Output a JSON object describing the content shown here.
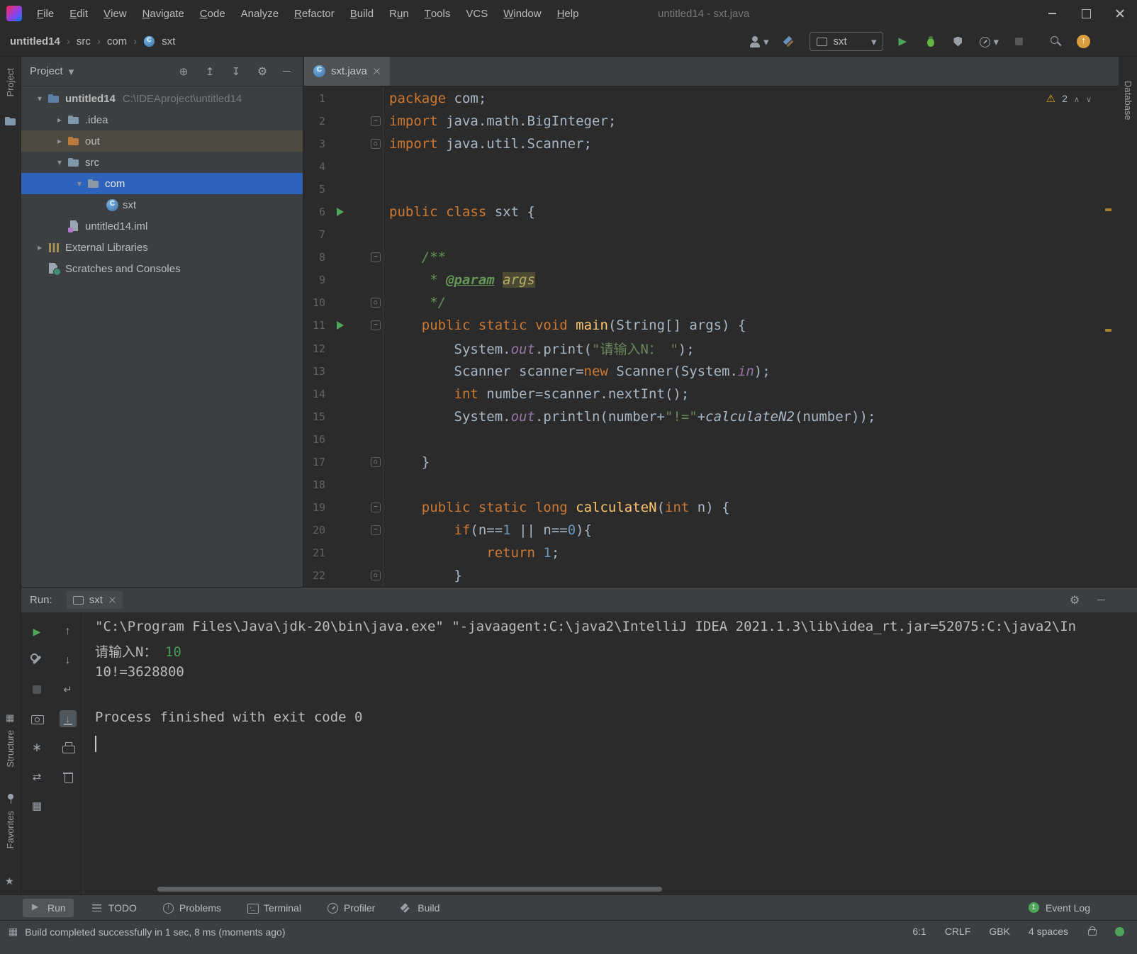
{
  "colors": {
    "background_editor": "#2b2b2b",
    "background_panel": "#3c3f41",
    "selection_blue": "#2d63bb",
    "tree_highlight_olive": "#4c4a41",
    "keyword_orange": "#cc7832",
    "string_green": "#6a8759",
    "number_blue": "#6897bb",
    "comment_green": "#629755",
    "method_yellow": "#ffc66d",
    "field_purple": "#9876aa",
    "run_green": "#4fa65a",
    "warning_yellow": "#d6a520",
    "console_input_green": "#499c54"
  },
  "window": {
    "title": "untitled14 - sxt.java"
  },
  "menubar": {
    "items": [
      {
        "label": "File",
        "u": 0
      },
      {
        "label": "Edit",
        "u": 0
      },
      {
        "label": "View",
        "u": 0
      },
      {
        "label": "Navigate",
        "u": 0
      },
      {
        "label": "Code",
        "u": 0
      },
      {
        "label": "Analyze",
        "u": null
      },
      {
        "label": "Refactor",
        "u": 0
      },
      {
        "label": "Build",
        "u": 0
      },
      {
        "label": "Run",
        "u": 1
      },
      {
        "label": "Tools",
        "u": 0
      },
      {
        "label": "VCS",
        "u": null
      },
      {
        "label": "Window",
        "u": 0
      },
      {
        "label": "Help",
        "u": 0
      }
    ]
  },
  "breadcrumbs": {
    "items": [
      {
        "label": "untitled14",
        "bold": true
      },
      {
        "label": "src"
      },
      {
        "label": "com"
      },
      {
        "label": "sxt",
        "icon": "class"
      }
    ]
  },
  "toolbar": {
    "run_config": "sxt"
  },
  "stripes": {
    "left_top": "Project",
    "left_bottom": [
      "Structure",
      "Favorites"
    ],
    "right_top": "Database"
  },
  "project": {
    "header": "Project",
    "tree": [
      {
        "indent": 0,
        "chevron": "down",
        "icon": "project-folder",
        "label": "untitled14",
        "bold": true,
        "path": "C:\\IDEAproject\\untitled14"
      },
      {
        "indent": 1,
        "chevron": "right",
        "icon": "folder",
        "label": ".idea"
      },
      {
        "indent": 1,
        "chevron": "right",
        "icon": "folder-out",
        "label": "out",
        "highlight": true
      },
      {
        "indent": 1,
        "chevron": "down",
        "icon": "folder-src",
        "label": "src"
      },
      {
        "indent": 2,
        "chevron": "down",
        "icon": "package",
        "label": "com",
        "selected": true
      },
      {
        "indent": 3,
        "chevron": null,
        "icon": "class",
        "label": "sxt"
      },
      {
        "indent": 1,
        "chevron": null,
        "icon": "iml",
        "label": "untitled14.iml"
      },
      {
        "indent": 0,
        "chevron": "right",
        "icon": "library",
        "label": "External Libraries"
      },
      {
        "indent": 0,
        "chevron": null,
        "icon": "scratches",
        "label": "Scratches and Consoles"
      }
    ]
  },
  "editor": {
    "tab": {
      "label": "sxt.java"
    },
    "warnings_count": "2",
    "lines": [
      {
        "n": "1",
        "seg": [
          [
            "k",
            "package"
          ],
          [
            "p",
            " com;"
          ]
        ]
      },
      {
        "n": "2",
        "fold": "start",
        "seg": [
          [
            "k",
            "import"
          ],
          [
            "p",
            " java.math.BigInteger;"
          ]
        ]
      },
      {
        "n": "3",
        "fold": "end",
        "seg": [
          [
            "k",
            "import"
          ],
          [
            "p",
            " java.util.Scanner;"
          ]
        ]
      },
      {
        "n": "4",
        "seg": []
      },
      {
        "n": "5",
        "seg": []
      },
      {
        "n": "6",
        "run": true,
        "seg": [
          [
            "k",
            "public"
          ],
          [
            "p",
            " "
          ],
          [
            "k",
            "class"
          ],
          [
            "p",
            " sxt {"
          ]
        ]
      },
      {
        "n": "7",
        "seg": []
      },
      {
        "n": "8",
        "fold": "start",
        "seg": [
          [
            "c",
            "    /**"
          ]
        ]
      },
      {
        "n": "9",
        "seg": [
          [
            "c",
            "     * "
          ],
          [
            "t",
            "@param"
          ],
          [
            "c",
            " "
          ],
          [
            "pr",
            "args"
          ]
        ]
      },
      {
        "n": "10",
        "fold": "end",
        "seg": [
          [
            "c",
            "     */"
          ]
        ]
      },
      {
        "n": "11",
        "run": true,
        "fold": "start",
        "seg": [
          [
            "p",
            "    "
          ],
          [
            "k",
            "public"
          ],
          [
            "p",
            " "
          ],
          [
            "k",
            "static"
          ],
          [
            "p",
            " "
          ],
          [
            "k",
            "void"
          ],
          [
            "p",
            " "
          ],
          [
            "m",
            "main"
          ],
          [
            "p",
            "(String[] args) {"
          ]
        ]
      },
      {
        "n": "12",
        "seg": [
          [
            "p",
            "        System."
          ],
          [
            "f",
            "out"
          ],
          [
            "p",
            ".print("
          ],
          [
            "s",
            "\"请输入N： \""
          ],
          [
            "p",
            ");"
          ]
        ]
      },
      {
        "n": "13",
        "seg": [
          [
            "p",
            "        Scanner scanner="
          ],
          [
            "k",
            "new"
          ],
          [
            "p",
            " Scanner(System."
          ],
          [
            "f",
            "in"
          ],
          [
            "p",
            ");"
          ]
        ]
      },
      {
        "n": "14",
        "seg": [
          [
            "p",
            "        "
          ],
          [
            "k",
            "int"
          ],
          [
            "p",
            " number=scanner.nextInt();"
          ]
        ]
      },
      {
        "n": "15",
        "seg": [
          [
            "p",
            "        System."
          ],
          [
            "f",
            "out"
          ],
          [
            "p",
            ".println(number+"
          ],
          [
            "s",
            "\"!=\""
          ],
          [
            "p",
            "+"
          ],
          [
            "sc",
            "calculateN2"
          ],
          [
            "p",
            "(number));"
          ]
        ]
      },
      {
        "n": "16",
        "seg": []
      },
      {
        "n": "17",
        "fold": "end",
        "seg": [
          [
            "p",
            "    }"
          ]
        ]
      },
      {
        "n": "18",
        "seg": []
      },
      {
        "n": "19",
        "fold": "start",
        "seg": [
          [
            "p",
            "    "
          ],
          [
            "k",
            "public"
          ],
          [
            "p",
            " "
          ],
          [
            "k",
            "static"
          ],
          [
            "p",
            " "
          ],
          [
            "k",
            "long"
          ],
          [
            "p",
            " "
          ],
          [
            "m",
            "calculateN"
          ],
          [
            "p",
            "("
          ],
          [
            "k",
            "int"
          ],
          [
            "p",
            " n) {"
          ]
        ]
      },
      {
        "n": "20",
        "fold": "start",
        "seg": [
          [
            "p",
            "        "
          ],
          [
            "k",
            "if"
          ],
          [
            "p",
            "(n=="
          ],
          [
            "d",
            "1"
          ],
          [
            "p",
            " || n=="
          ],
          [
            "d",
            "0"
          ],
          [
            "p",
            "){"
          ]
        ]
      },
      {
        "n": "21",
        "seg": [
          [
            "p",
            "            "
          ],
          [
            "k",
            "return"
          ],
          [
            "p",
            " "
          ],
          [
            "d",
            "1"
          ],
          [
            "p",
            ";"
          ]
        ]
      },
      {
        "n": "22",
        "fold": "end",
        "seg": [
          [
            "p",
            "        }"
          ]
        ]
      }
    ]
  },
  "run": {
    "label": "Run:",
    "tab": "sxt",
    "console": [
      {
        "seg": [
          [
            "p",
            "\"C:\\Program Files\\Java\\jdk-20\\bin\\java.exe\" \"-javaagent:C:\\java2\\IntelliJ IDEA 2021.1.3\\lib\\idea_rt.jar=52075:C:\\java2\\In"
          ]
        ]
      },
      {
        "seg": [
          [
            "p",
            "请输入N： "
          ],
          [
            "in",
            "10"
          ]
        ]
      },
      {
        "seg": [
          [
            "p",
            "10!=3628800"
          ]
        ]
      },
      {
        "seg": []
      },
      {
        "seg": [
          [
            "p",
            "Process finished with exit code 0"
          ]
        ]
      }
    ]
  },
  "bottombar": {
    "items": [
      {
        "label": "Run",
        "icon": "run",
        "active": true
      },
      {
        "label": "TODO",
        "icon": "todo"
      },
      {
        "label": "Problems",
        "icon": "problems"
      },
      {
        "label": "Terminal",
        "icon": "terminal"
      },
      {
        "label": "Profiler",
        "icon": "profiler"
      },
      {
        "label": "Build",
        "icon": "build"
      }
    ],
    "right": {
      "label": "Event Log",
      "badge": "1"
    }
  },
  "statusbar": {
    "message": "Build completed successfully in 1 sec, 8 ms (moments ago)",
    "position": "6:1",
    "line_ending": "CRLF",
    "encoding": "GBK",
    "indent": "4 spaces"
  }
}
